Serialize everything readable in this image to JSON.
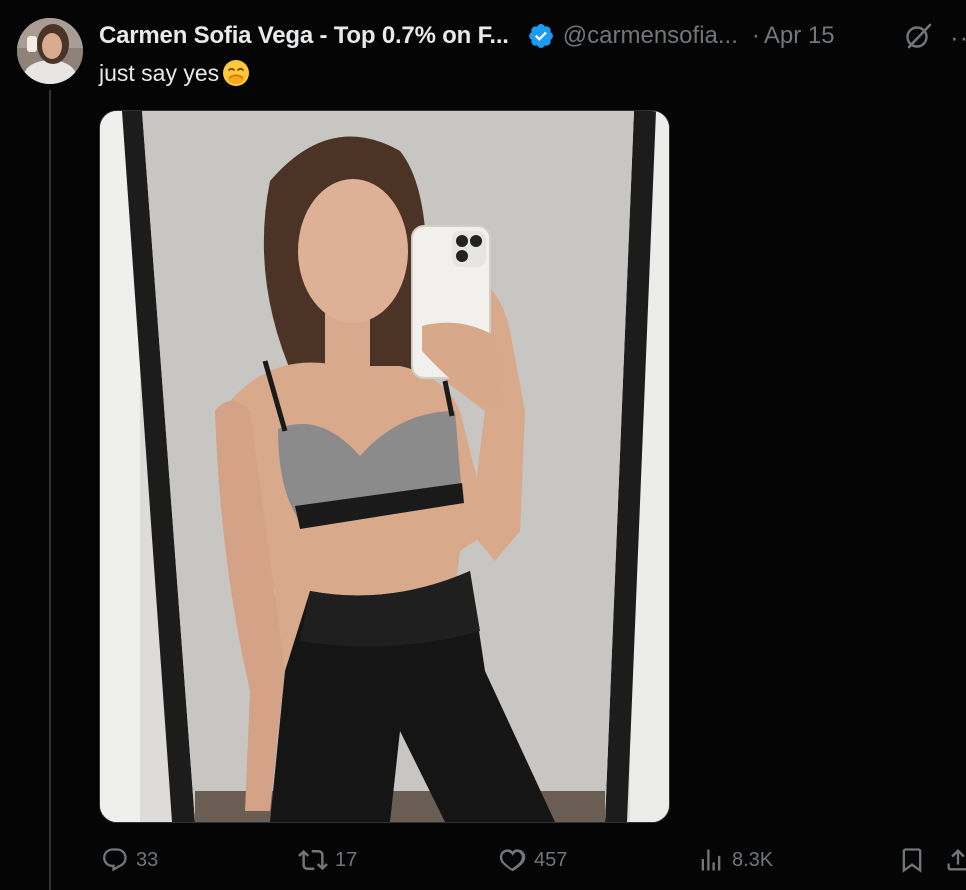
{
  "tweet": {
    "display_name": "Carmen Sofia Vega - Top 0.7% on F...",
    "handle": "@carmensofia...",
    "separator": "·",
    "date": "Apr 15",
    "text": "just say yes",
    "emoji": "🤭",
    "verified": true,
    "verified_color": "#1d9bf0",
    "avatar_icon": "avatar",
    "media_description_icon": "photo",
    "more_icon": "ellipsis-icon",
    "grok_icon": "grok-icon"
  },
  "actions": {
    "reply": {
      "icon": "reply-icon",
      "count": "33"
    },
    "retweet": {
      "icon": "retweet-icon",
      "count": "17"
    },
    "like": {
      "icon": "heart-icon",
      "count": "457"
    },
    "views": {
      "icon": "views-icon",
      "count": "8.3K"
    },
    "bookmark": {
      "icon": "bookmark-icon"
    },
    "share": {
      "icon": "share-icon"
    }
  },
  "colors": {
    "background": "#050505",
    "text_primary": "#e7e9ea",
    "text_secondary": "#71767b",
    "accent": "#1d9bf0"
  }
}
